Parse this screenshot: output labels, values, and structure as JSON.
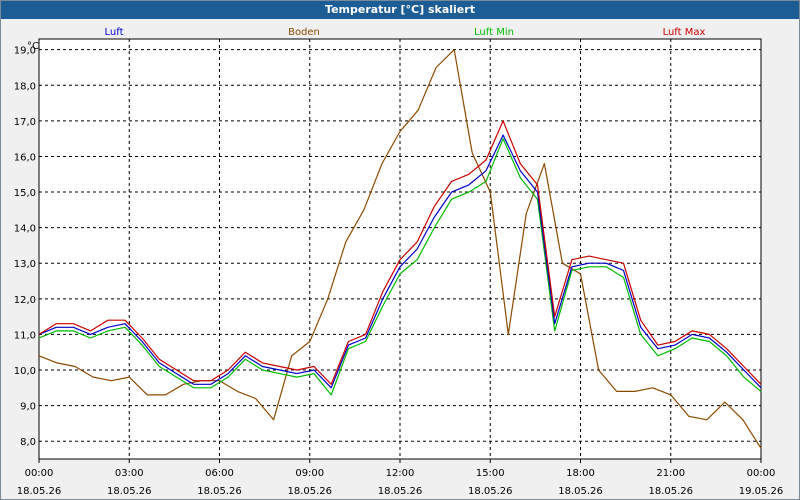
{
  "window": {
    "title": "Temperatur [°C] skaliert"
  },
  "colors": {
    "luft": "#0000cc",
    "boden": "#8b4a00",
    "luft_min": "#00bb00",
    "luft_max": "#cc0000",
    "grid": "#000000",
    "background": "#ffffff"
  },
  "chart_data": {
    "type": "line",
    "title": "Temperatur [°C] skaliert",
    "ylabel": "°C",
    "xlabel": "",
    "ylim": [
      7.5,
      19.3
    ],
    "yticks": [
      "8,0",
      "9,0",
      "10,0",
      "11,0",
      "12,0",
      "13,0",
      "14,0",
      "15,0",
      "16,0",
      "17,0",
      "18,0",
      "19,0"
    ],
    "ytick_values": [
      8,
      9,
      10,
      11,
      12,
      13,
      14,
      15,
      16,
      17,
      18,
      19
    ],
    "xlim": [
      0,
      24
    ],
    "xticks": [
      {
        "time": "00:00",
        "date": "18.05.26"
      },
      {
        "time": "03:00",
        "date": "18.05.26"
      },
      {
        "time": "06:00",
        "date": "18.05.26"
      },
      {
        "time": "09:00",
        "date": "18.05.26"
      },
      {
        "time": "12:00",
        "date": "18.05.26"
      },
      {
        "time": "15:00",
        "date": "18.05.26"
      },
      {
        "time": "18:00",
        "date": "18.05.26"
      },
      {
        "time": "21:00",
        "date": "18.05.26"
      },
      {
        "time": "00:00",
        "date": "19.05.26"
      }
    ],
    "xtick_values": [
      0,
      3,
      6,
      9,
      12,
      15,
      18,
      21,
      24
    ],
    "grid": true,
    "legend": "top",
    "x": [
      0,
      0.5,
      1,
      1.5,
      2,
      2.5,
      3,
      3.5,
      4,
      4.5,
      5,
      5.5,
      6,
      6.5,
      7,
      7.5,
      8,
      8.5,
      9,
      9.5,
      10,
      10.5,
      11,
      11.5,
      12,
      12.5,
      13,
      13.5,
      14,
      14.5,
      15,
      15.5,
      16,
      16.5,
      17,
      17.5,
      18,
      18.5,
      19,
      19.5,
      20,
      20.5,
      21,
      21.5,
      22,
      22.5,
      23,
      23.5,
      24
    ],
    "series": [
      {
        "name": "Luft",
        "values": [
          11.0,
          11.2,
          11.2,
          11.0,
          11.2,
          11.3,
          10.8,
          10.2,
          9.9,
          9.6,
          9.6,
          9.9,
          10.4,
          10.1,
          10.0,
          9.9,
          10.0,
          9.5,
          10.7,
          10.9,
          12.0,
          12.9,
          13.4,
          14.3,
          15.0,
          15.2,
          15.6,
          16.6,
          15.6,
          15.0,
          11.3,
          12.9,
          13.0,
          13.0,
          12.8,
          11.2,
          10.6,
          10.7,
          11.0,
          10.9,
          10.5,
          10.0,
          9.5
        ]
      },
      {
        "name": "Boden",
        "values": [
          10.4,
          10.2,
          10.1,
          9.8,
          9.7,
          9.8,
          9.3,
          9.3,
          9.6,
          9.7,
          9.7,
          9.4,
          9.2,
          8.6,
          10.4,
          10.8,
          12.0,
          13.6,
          14.5,
          15.8,
          16.7,
          17.3,
          18.5,
          19.0,
          16.1,
          15.0,
          11.0,
          14.4,
          15.8,
          13.0,
          12.7,
          10.0,
          9.4,
          9.4,
          9.5,
          9.3,
          8.7,
          8.6,
          9.1,
          8.6,
          7.8
        ]
      },
      {
        "name": "Luft Min",
        "values": [
          10.9,
          11.1,
          11.1,
          10.9,
          11.1,
          11.2,
          10.7,
          10.1,
          9.8,
          9.5,
          9.5,
          9.8,
          10.3,
          10.0,
          9.9,
          9.8,
          9.9,
          9.3,
          10.6,
          10.8,
          11.8,
          12.7,
          13.1,
          14.0,
          14.8,
          15.0,
          15.3,
          16.5,
          15.4,
          14.8,
          11.1,
          12.8,
          12.9,
          12.9,
          12.6,
          11.0,
          10.4,
          10.6,
          10.9,
          10.8,
          10.4,
          9.8,
          9.4
        ]
      },
      {
        "name": "Luft Max",
        "values": [
          11.0,
          11.3,
          11.3,
          11.1,
          11.4,
          11.4,
          10.9,
          10.3,
          10.0,
          9.7,
          9.7,
          10.0,
          10.5,
          10.2,
          10.1,
          10.0,
          10.1,
          9.6,
          10.8,
          11.0,
          12.2,
          13.1,
          13.6,
          14.6,
          15.3,
          15.5,
          15.9,
          17.0,
          15.8,
          15.2,
          11.5,
          13.1,
          13.2,
          13.1,
          13.0,
          11.4,
          10.7,
          10.8,
          11.1,
          11.0,
          10.6,
          10.1,
          9.6
        ]
      }
    ]
  }
}
